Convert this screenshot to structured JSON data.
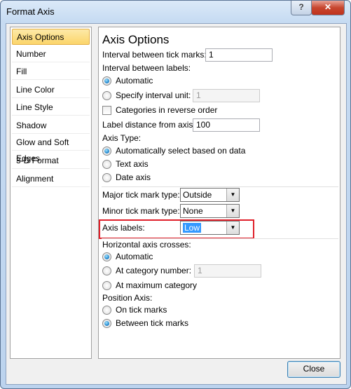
{
  "window": {
    "title": "Format Axis",
    "help_label": "?",
    "close_label": "✕"
  },
  "sidebar": {
    "items": [
      {
        "label": "Axis Options",
        "selected": true
      },
      {
        "label": "Number"
      },
      {
        "label": "Fill"
      },
      {
        "label": "Line Color"
      },
      {
        "label": "Line Style"
      },
      {
        "label": "Shadow"
      },
      {
        "label": "Glow and Soft Edges"
      },
      {
        "label": "3-D Format"
      },
      {
        "label": "Alignment"
      }
    ]
  },
  "main": {
    "heading": "Axis Options",
    "tick_interval_label": "Interval between tick marks:",
    "tick_interval_value": "1",
    "label_interval_label": "Interval between labels:",
    "automatic_label": "Automatic",
    "specify_label": "Specify interval unit:",
    "specify_value": "1",
    "reverse_label": "Categories in reverse order",
    "label_distance_label": "Label distance from axis:",
    "label_distance_value": "100",
    "axis_type_label": "Axis Type:",
    "auto_select_label": "Automatically select based on data",
    "text_axis_label": "Text axis",
    "date_axis_label": "Date axis",
    "major_label": "Major tick mark type:",
    "major_value": "Outside",
    "minor_label": "Minor tick mark type:",
    "minor_value": "None",
    "axis_labels_label": "Axis labels:",
    "axis_labels_value": "Low",
    "h_crosses_label": "Horizontal axis crosses:",
    "cross_auto_label": "Automatic",
    "cross_cat_label": "At category number:",
    "cross_cat_value": "1",
    "cross_max_label": "At maximum category",
    "position_label": "Position Axis:",
    "on_tick_label": "On tick marks",
    "between_label": "Between tick marks",
    "highlight_color": "#e0202a"
  },
  "footer": {
    "close_label": "Close"
  }
}
